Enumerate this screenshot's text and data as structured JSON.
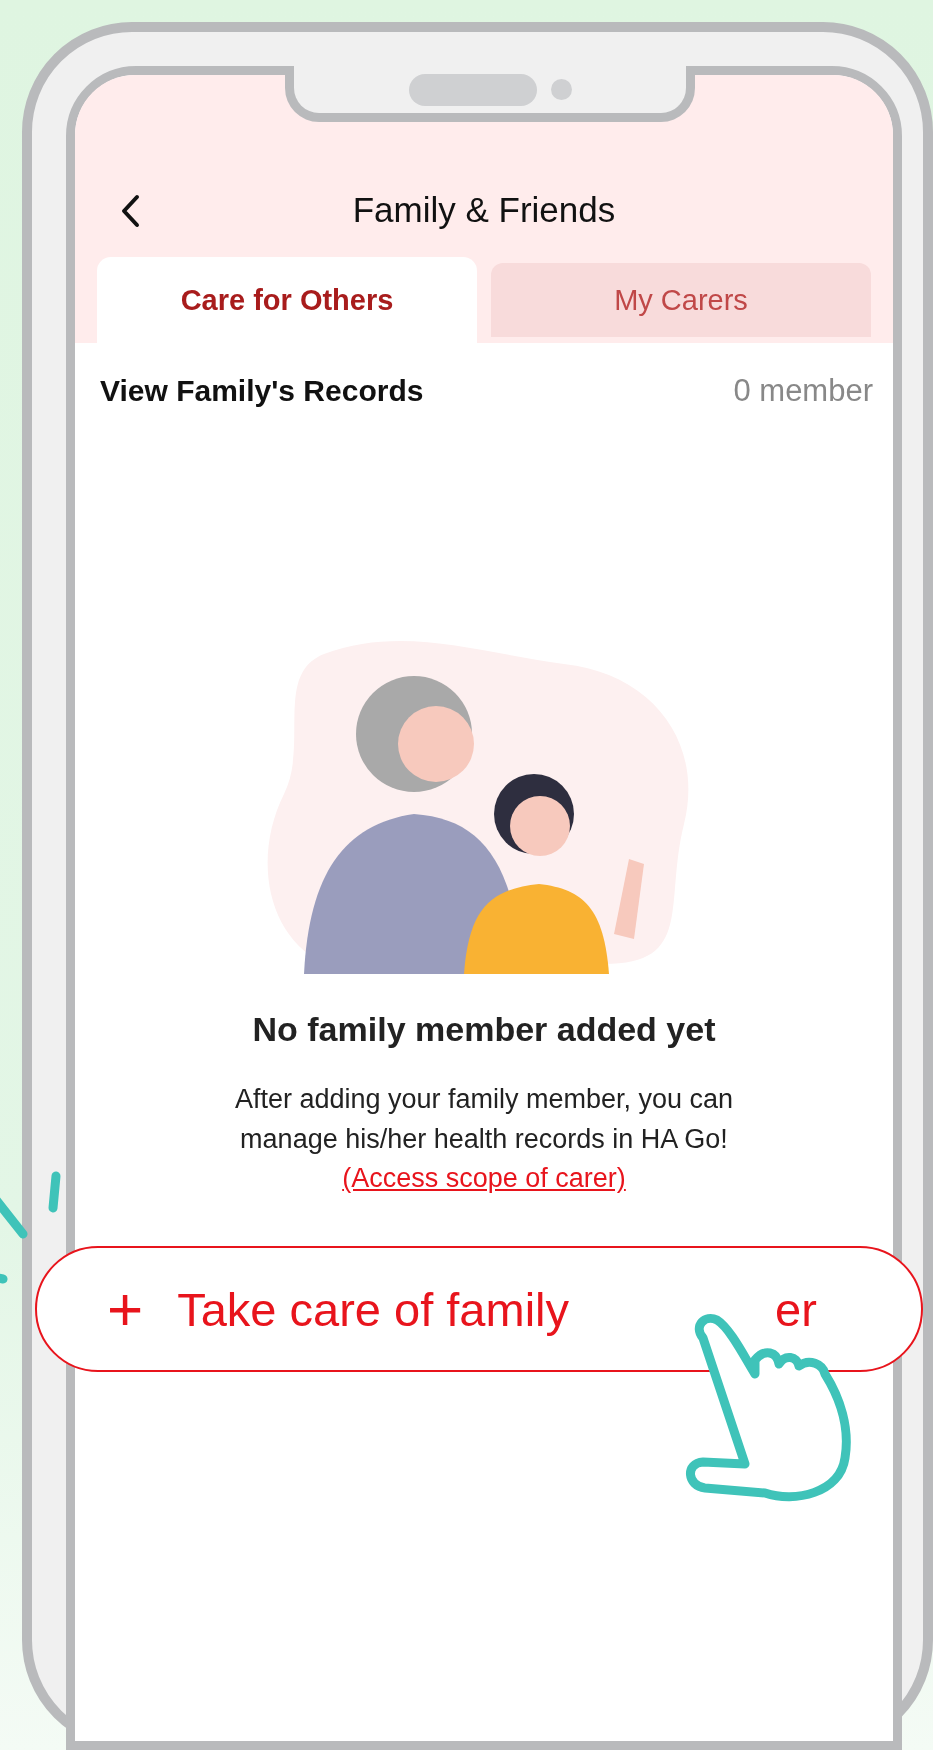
{
  "header": {
    "title": "Family & Friends"
  },
  "tabs": [
    {
      "label": "Care for Others",
      "selected": true
    },
    {
      "label": "My Carers",
      "selected": false
    }
  ],
  "section": {
    "title": "View Family's Records",
    "count": "0 member"
  },
  "empty_state": {
    "heading": "No family member added yet",
    "body": "After adding your family member, you can manage his/her health records in HA Go!",
    "link": "(Access scope of carer)"
  },
  "action_button": {
    "icon": "+",
    "label_parts": [
      "Take care of family",
      "er"
    ]
  }
}
